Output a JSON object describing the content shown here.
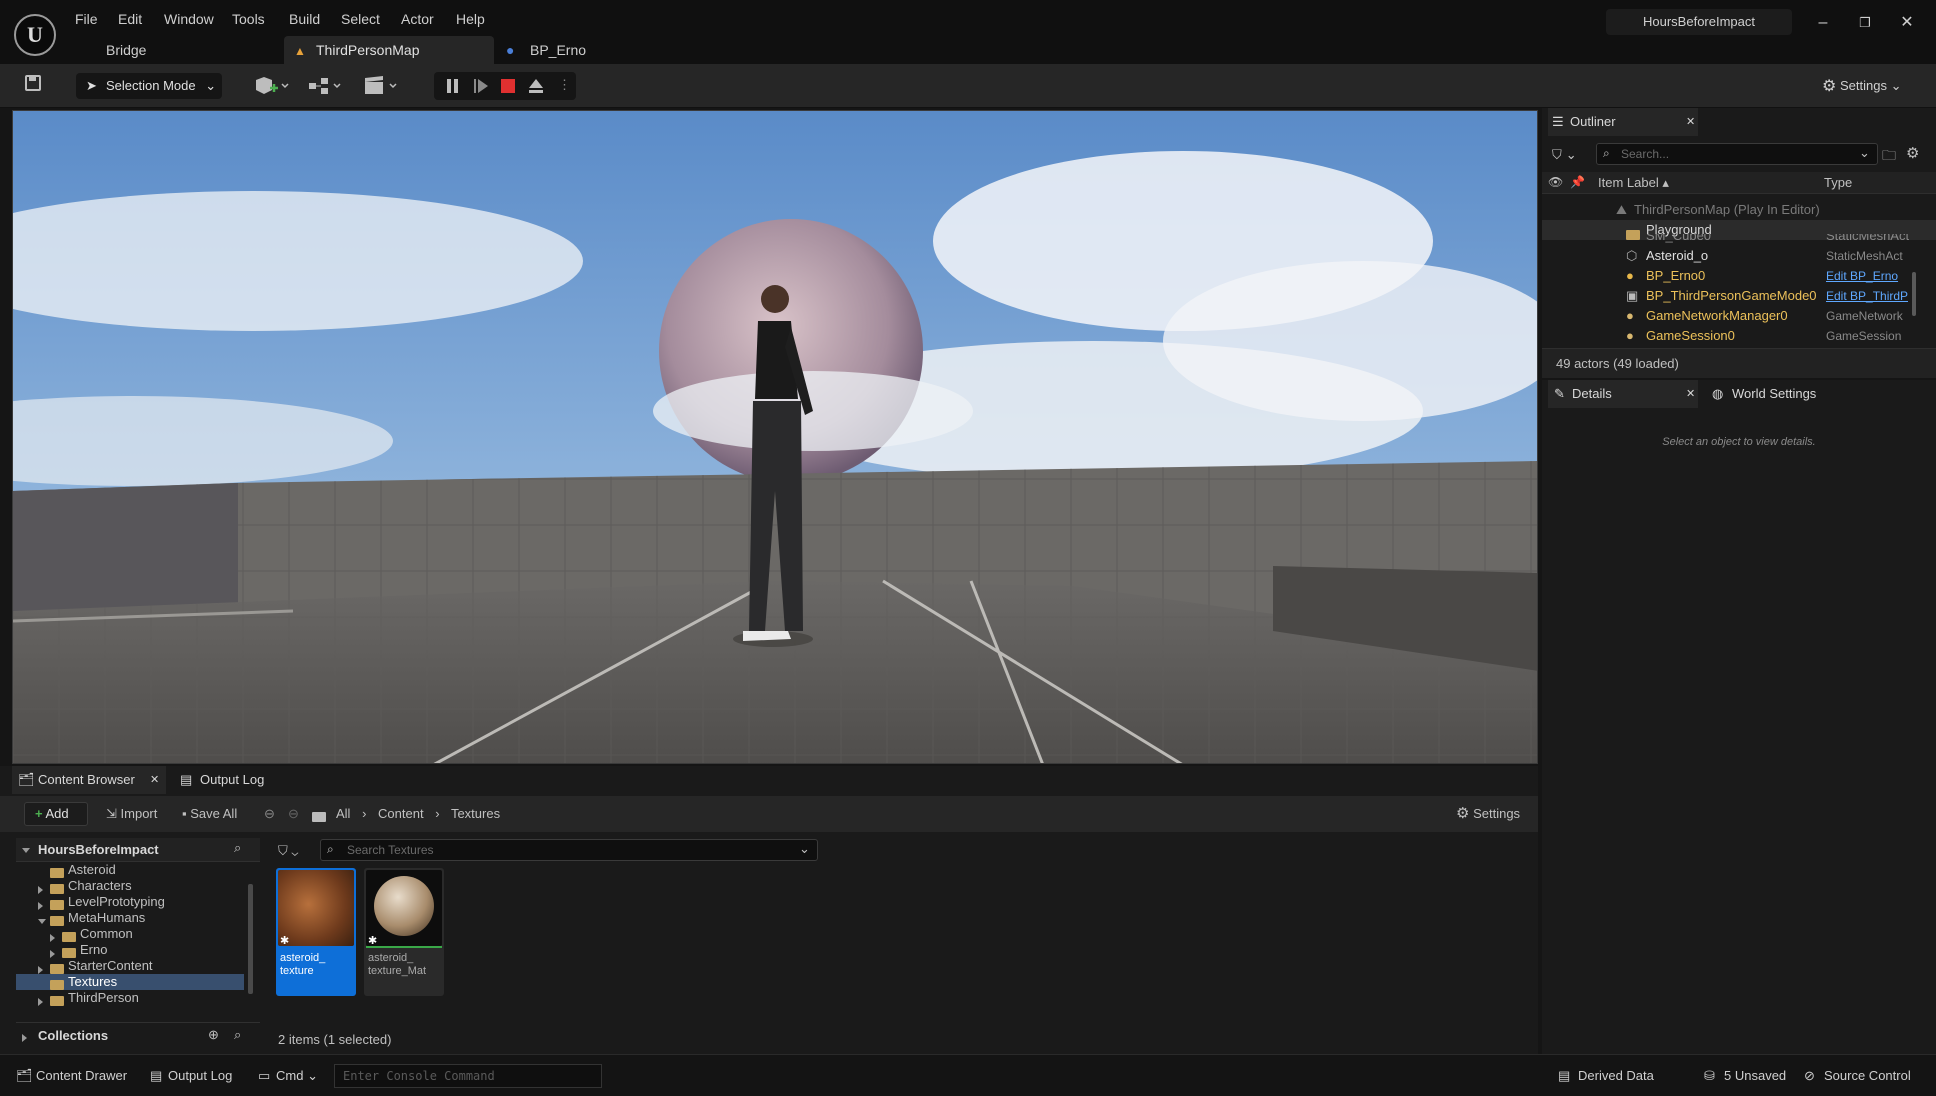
{
  "menu": [
    "File",
    "Edit",
    "Window",
    "Tools",
    "Build",
    "Select",
    "Actor",
    "Help"
  ],
  "tabs": {
    "bridge": "Bridge",
    "map": "ThirdPersonMap",
    "bp": "BP_Erno"
  },
  "project_name": "HoursBeforeImpact",
  "toolbar": {
    "selection_mode": "Selection Mode",
    "settings": "Settings"
  },
  "outliner": {
    "title": "Outliner",
    "search_placeholder": "Search...",
    "col_label": "Item Label",
    "col_type": "Type",
    "root": "ThirdPersonMap (Play In Editor)",
    "folder": "Playground",
    "partial": "SM_Cube0",
    "partial_type": "StaticMeshAct",
    "rows": [
      {
        "label": "Asteroid_o",
        "type": "StaticMeshAct",
        "link": false
      },
      {
        "label": "BP_Erno0",
        "type": "Edit BP_Erno",
        "link": true
      },
      {
        "label": "BP_ThirdPersonGameMode0",
        "type": "Edit BP_ThirdP",
        "link": true
      },
      {
        "label": "GameNetworkManager0",
        "type": "GameNetwork",
        "link": false
      },
      {
        "label": "GameSession0",
        "type": "GameSession",
        "link": false
      }
    ],
    "count": "49 actors (49 loaded)"
  },
  "details": {
    "title": "Details",
    "world_settings": "World Settings",
    "empty": "Select an object to view details."
  },
  "content_browser": {
    "tab": "Content Browser",
    "output_tab": "Output Log",
    "add": "Add",
    "import": "Import",
    "save_all": "Save All",
    "crumbs": [
      "All",
      "Content",
      "Textures"
    ],
    "settings": "Settings",
    "project": "HoursBeforeImpact",
    "search_placeholder": "Search Textures",
    "tree": [
      {
        "label": "Asteroid",
        "indent": 0,
        "arrow": "none",
        "selected": false
      },
      {
        "label": "Characters",
        "indent": 0,
        "arrow": "right",
        "selected": false
      },
      {
        "label": "LevelPrototyping",
        "indent": 0,
        "arrow": "right",
        "selected": false
      },
      {
        "label": "MetaHumans",
        "indent": 0,
        "arrow": "down",
        "selected": false
      },
      {
        "label": "Common",
        "indent": 1,
        "arrow": "right",
        "selected": false
      },
      {
        "label": "Erno",
        "indent": 1,
        "arrow": "right",
        "selected": false
      },
      {
        "label": "StarterContent",
        "indent": 0,
        "arrow": "right",
        "selected": false
      },
      {
        "label": "Textures",
        "indent": 0,
        "arrow": "none",
        "selected": true
      },
      {
        "label": "ThirdPerson",
        "indent": 0,
        "arrow": "right",
        "selected": false
      }
    ],
    "collections": "Collections",
    "assets": [
      {
        "line1": "asteroid_",
        "line2": "texture"
      },
      {
        "line1": "asteroid_",
        "line2": "texture_Mat"
      }
    ],
    "item_count": "2 items (1 selected)"
  },
  "statusbar": {
    "content_drawer": "Content Drawer",
    "output_log": "Output Log",
    "cmd": "Cmd",
    "console_placeholder": "Enter Console Command",
    "derived_data": "Derived Data",
    "unsaved": "5 Unsaved",
    "source_control": "Source Control"
  }
}
